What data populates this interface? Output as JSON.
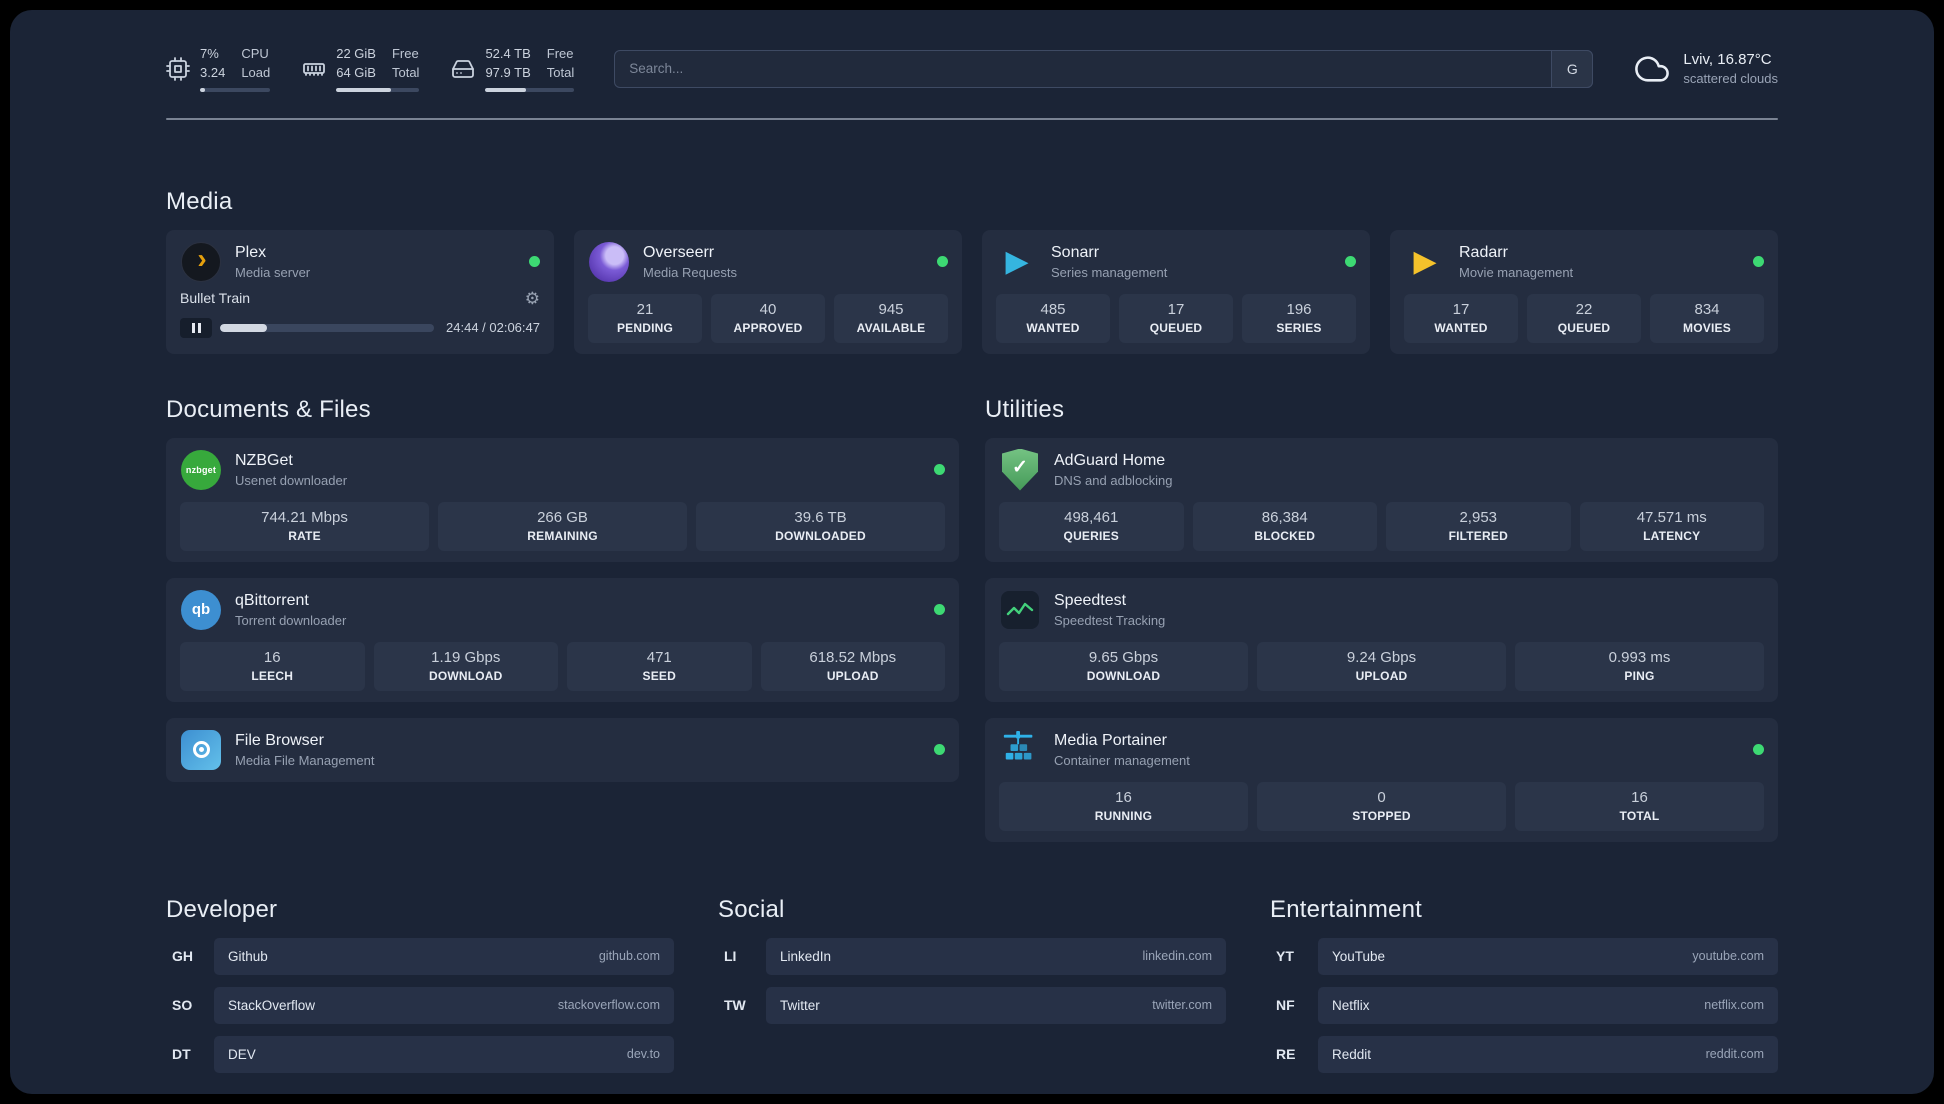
{
  "colors": {
    "page_bg": "#1b2436",
    "card_bg": "#242d40",
    "tile_bg": "#2b3549",
    "status_green": "#3dd973",
    "plex_orange": "#e5a00d",
    "overseerr_purple": "#7b5bd6",
    "sonarr_blue": "#35b5e0",
    "radarr_yellow": "#f5c22b",
    "nzbget_green": "#37a93c",
    "qbittorrent_blue": "#3d8fd1",
    "filebrowser_blue": "#63c0ea",
    "adguard_green": "#68bc71",
    "speedtest_green": "#43d17c",
    "portainer_blue": "#2fb1e8"
  },
  "icons": {
    "gear": "⚙",
    "play": "▶",
    "plex_chevron": "›",
    "check": "✓",
    "nzbget_text": "nzbget",
    "qbittorrent_text": "qb"
  },
  "topbar": {
    "cpu": {
      "value1": "7%",
      "value2": "3.24",
      "label1": "CPU",
      "label2": "Load",
      "bar": "7%"
    },
    "memory": {
      "value1": "22 GiB",
      "value2": "64 GiB",
      "label1": "Free",
      "label2": "Total",
      "bar": "66%"
    },
    "disk": {
      "value1": "52.4 TB",
      "value2": "97.9 TB",
      "label1": "Free",
      "label2": "Total",
      "bar": "46%"
    },
    "search": {
      "placeholder": "Search...",
      "provider": "G"
    },
    "weather": {
      "location": "Lviv, 16.87°C",
      "condition": "scattered clouds"
    }
  },
  "media": {
    "title": "Media",
    "plex": {
      "name": "Plex",
      "desc": "Media server",
      "player": {
        "track": "Bullet Train",
        "time": "24:44 / 02:06:47",
        "progress": "22%"
      }
    },
    "overseerr": {
      "name": "Overseerr",
      "desc": "Media Requests",
      "stats": [
        {
          "value": "21",
          "label": "PENDING"
        },
        {
          "value": "40",
          "label": "APPROVED"
        },
        {
          "value": "945",
          "label": "AVAILABLE"
        }
      ]
    },
    "sonarr": {
      "name": "Sonarr",
      "desc": "Series management",
      "stats": [
        {
          "value": "485",
          "label": "WANTED"
        },
        {
          "value": "17",
          "label": "QUEUED"
        },
        {
          "value": "196",
          "label": "SERIES"
        }
      ]
    },
    "radarr": {
      "name": "Radarr",
      "desc": "Movie management",
      "stats": [
        {
          "value": "17",
          "label": "WANTED"
        },
        {
          "value": "22",
          "label": "QUEUED"
        },
        {
          "value": "834",
          "label": "MOVIES"
        }
      ]
    }
  },
  "documents": {
    "title": "Documents & Files",
    "nzbget": {
      "name": "NZBGet",
      "desc": "Usenet downloader",
      "stats": [
        {
          "value": "744.21 Mbps",
          "label": "RATE"
        },
        {
          "value": "266 GB",
          "label": "REMAINING"
        },
        {
          "value": "39.6 TB",
          "label": "DOWNLOADED"
        }
      ]
    },
    "qbittorrent": {
      "name": "qBittorrent",
      "desc": "Torrent downloader",
      "stats": [
        {
          "value": "16",
          "label": "LEECH"
        },
        {
          "value": "1.19 Gbps",
          "label": "DOWNLOAD"
        },
        {
          "value": "471",
          "label": "SEED"
        },
        {
          "value": "618.52 Mbps",
          "label": "UPLOAD"
        }
      ]
    },
    "filebrowser": {
      "name": "File Browser",
      "desc": "Media File Management"
    }
  },
  "utilities": {
    "title": "Utilities",
    "adguard": {
      "name": "AdGuard Home",
      "desc": "DNS and adblocking",
      "stats": [
        {
          "value": "498,461",
          "label": "QUERIES"
        },
        {
          "value": "86,384",
          "label": "BLOCKED"
        },
        {
          "value": "2,953",
          "label": "FILTERED"
        },
        {
          "value": "47.571 ms",
          "label": "LATENCY"
        }
      ]
    },
    "speedtest": {
      "name": "Speedtest",
      "desc": "Speedtest Tracking",
      "stats": [
        {
          "value": "9.65 Gbps",
          "label": "DOWNLOAD"
        },
        {
          "value": "9.24 Gbps",
          "label": "UPLOAD"
        },
        {
          "value": "0.993 ms",
          "label": "PING"
        }
      ]
    },
    "portainer": {
      "name": "Media Portainer",
      "desc": "Container management",
      "stats": [
        {
          "value": "16",
          "label": "RUNNING"
        },
        {
          "value": "0",
          "label": "STOPPED"
        },
        {
          "value": "16",
          "label": "TOTAL"
        }
      ]
    }
  },
  "bookmarks": {
    "developer": {
      "title": "Developer",
      "items": [
        {
          "abbr": "GH",
          "name": "Github",
          "domain": "github.com"
        },
        {
          "abbr": "SO",
          "name": "StackOverflow",
          "domain": "stackoverflow.com"
        },
        {
          "abbr": "DT",
          "name": "DEV",
          "domain": "dev.to"
        }
      ]
    },
    "social": {
      "title": "Social",
      "items": [
        {
          "abbr": "LI",
          "name": "LinkedIn",
          "domain": "linkedin.com"
        },
        {
          "abbr": "TW",
          "name": "Twitter",
          "domain": "twitter.com"
        }
      ]
    },
    "entertainment": {
      "title": "Entertainment",
      "items": [
        {
          "abbr": "YT",
          "name": "YouTube",
          "domain": "youtube.com"
        },
        {
          "abbr": "NF",
          "name": "Netflix",
          "domain": "netflix.com"
        },
        {
          "abbr": "RE",
          "name": "Reddit",
          "domain": "reddit.com"
        }
      ]
    }
  }
}
